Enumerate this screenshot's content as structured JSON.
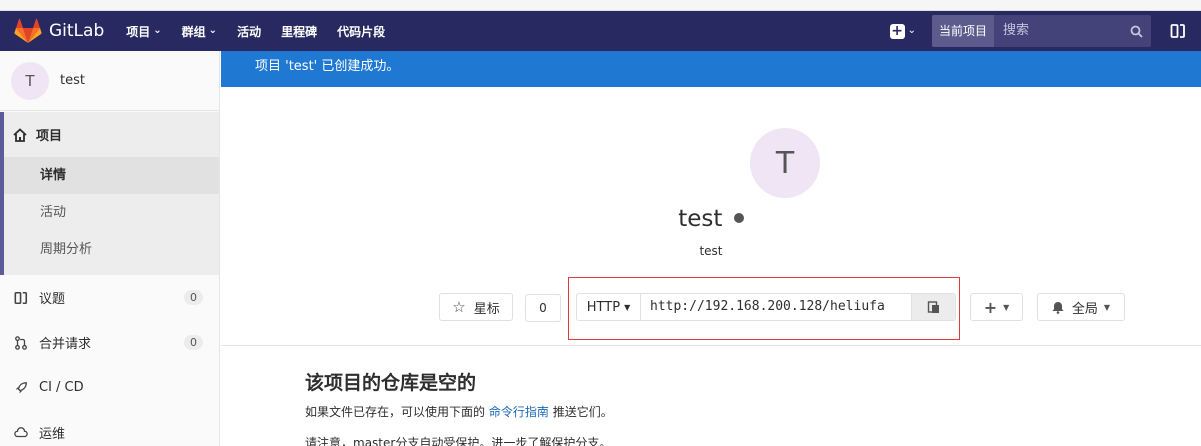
{
  "navbar": {
    "brand": "GitLab",
    "links": [
      "项目",
      "群组",
      "活动",
      "里程碑",
      "代码片段"
    ],
    "search_scope": "当前项目",
    "search_placeholder": "搜索",
    "bg_color": "#292961"
  },
  "sidebar": {
    "context_avatar": "T",
    "context_name": "test",
    "project_label": "项目",
    "sub_items": [
      "详情",
      "活动",
      "周期分析"
    ],
    "issues_label": "议题",
    "issues_count": "0",
    "mr_label": "合并请求",
    "mr_count": "0",
    "cicd_label": "CI / CD",
    "ops_label": "运维"
  },
  "flash": {
    "message": "项目 'test' 已创建成功。",
    "color": "#1f78d1"
  },
  "project": {
    "avatar": "T",
    "name": "test",
    "subtitle": "test"
  },
  "actions": {
    "star_label": "星标",
    "star_count": "0",
    "clone_protocol": "HTTP",
    "clone_url": "http://192.168.200.128/heliufa",
    "notification_label": "全局"
  },
  "empty": {
    "title": "该项目的仓库是空的",
    "text_before": "如果文件已存在，可以使用下面的",
    "link": "命令行指南",
    "text_after": "推送它们。",
    "partial_line": "请注意，master分支自动受保护。进一步了解保护分支。"
  }
}
